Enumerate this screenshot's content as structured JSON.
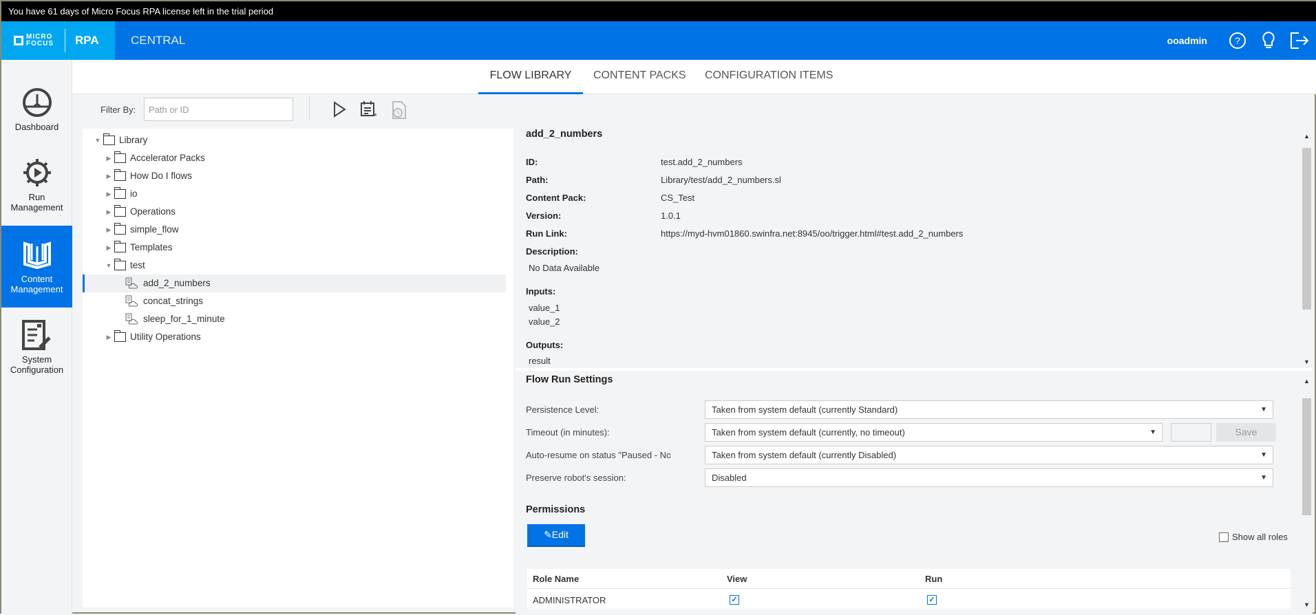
{
  "banner": "You have 61 days of Micro Focus RPA license left in the trial period",
  "header": {
    "logo_line1": "MICRO",
    "logo_line2": "FOCUS",
    "product": "RPA",
    "section": "CENTRAL",
    "user": "ooadmin",
    "icons": [
      "help-icon",
      "lightbulb-icon",
      "logout-icon"
    ],
    "accent": "#0073e7",
    "logo_bg": "#00a7f0"
  },
  "sidebar": {
    "items": [
      {
        "label1": "Dashboard",
        "label2": "",
        "icon": "dashboard-gauge-icon"
      },
      {
        "label1": "Run",
        "label2": "Management",
        "icon": "run-gear-icon"
      },
      {
        "label1": "Content",
        "label2": "Management",
        "icon": "book-icon",
        "active": true
      },
      {
        "label1": "System",
        "label2": "Configuration",
        "icon": "system-config-icon"
      }
    ]
  },
  "tabs": [
    {
      "label": "FLOW LIBRARY",
      "active": true
    },
    {
      "label": "CONTENT PACKS"
    },
    {
      "label": "CONFIGURATION ITEMS"
    }
  ],
  "toolbar": {
    "filter_label": "Filter By:",
    "filter_placeholder": "Path or ID",
    "filter_value": ""
  },
  "tree": [
    {
      "label": "Library",
      "type": "folder",
      "expanded": true,
      "level": 0
    },
    {
      "label": "Accelerator Packs",
      "type": "folder",
      "level": 1
    },
    {
      "label": "How Do I flows",
      "type": "folder",
      "level": 1
    },
    {
      "label": "io",
      "type": "folder",
      "level": 1
    },
    {
      "label": "Operations",
      "type": "folder",
      "level": 1
    },
    {
      "label": "simple_flow",
      "type": "folder",
      "level": 1
    },
    {
      "label": "Templates",
      "type": "folder",
      "level": 1
    },
    {
      "label": "test",
      "type": "folder",
      "expanded": true,
      "level": 1
    },
    {
      "label": "add_2_numbers",
      "type": "flow",
      "level": 2,
      "selected": true
    },
    {
      "label": "concat_strings",
      "type": "flow",
      "level": 2
    },
    {
      "label": "sleep_for_1_minute",
      "type": "flow",
      "level": 2
    },
    {
      "label": "Utility Operations",
      "type": "folder",
      "level": 1
    }
  ],
  "details": {
    "title": "add_2_numbers",
    "fields": [
      {
        "label": "ID:",
        "value": "test.add_2_numbers"
      },
      {
        "label": "Path:",
        "value": "Library/test/add_2_numbers.sl"
      },
      {
        "label": "Content Pack:",
        "value": "CS_Test"
      },
      {
        "label": "Version:",
        "value": "1.0.1"
      },
      {
        "label": "Run Link:",
        "value": "https://myd-hvm01860.swinfra.net:8945/oo/trigger.html#test.add_2_numbers"
      }
    ],
    "description_label": "Description:",
    "description": "No Data Available",
    "inputs_label": "Inputs:",
    "inputs": [
      "value_1",
      "value_2"
    ],
    "outputs_label": "Outputs:",
    "outputs": [
      "result"
    ]
  },
  "settings": {
    "title": "Flow Run Settings",
    "rows": [
      {
        "label": "Persistence Level:",
        "value": "Taken from system default (currently Standard)"
      },
      {
        "label": "Timeout (in minutes):",
        "value": "Taken from system default (currently, no timeout)"
      },
      {
        "label": "Auto-resume on status \"Paused - No W...",
        "value": "Taken from system default (currently Disabled)"
      },
      {
        "label": "Preserve robot's session:",
        "value": "Disabled"
      }
    ],
    "timeout_input": "",
    "save_label": "Save"
  },
  "permissions": {
    "title": "Permissions",
    "edit_label": "Edit",
    "show_all_roles": "Show all roles",
    "show_all_checked": false,
    "columns": [
      "Role Name",
      "View",
      "Run"
    ],
    "rows": [
      {
        "role": "ADMINISTRATOR",
        "view": true,
        "run": true
      }
    ]
  }
}
